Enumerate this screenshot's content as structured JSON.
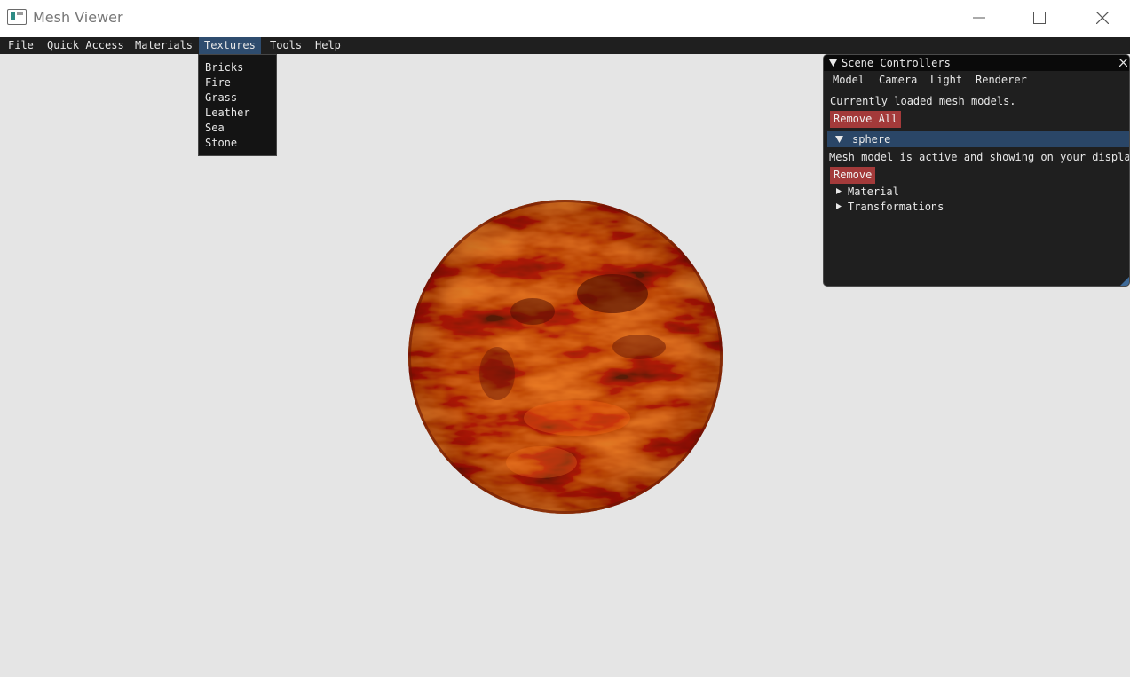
{
  "window": {
    "title": "Mesh Viewer",
    "controls": {
      "minimize": "minimize-icon",
      "maximize": "maximize-icon",
      "close": "close-icon"
    }
  },
  "menubar": {
    "items": [
      {
        "label": "File"
      },
      {
        "label": "Quick Access"
      },
      {
        "label": "Materials"
      },
      {
        "label": "Textures"
      },
      {
        "label": "Tools"
      },
      {
        "label": "Help"
      }
    ],
    "active": "Textures"
  },
  "textures_menu": {
    "items": [
      "Bricks",
      "Fire",
      "Grass",
      "Leather",
      "Sea",
      "Stone"
    ]
  },
  "scene": {
    "background": "#e5e5e5",
    "model": "sphere",
    "texture_colors": {
      "base": "#b8320c",
      "highlight": "#ff6a1a",
      "dark": "#4a0c02"
    }
  },
  "panel": {
    "title": "Scene Controllers",
    "collapse_icon": "triangle-down-icon",
    "close_icon": "close-icon",
    "tabs": [
      "Model",
      "Camera",
      "Light",
      "Renderer"
    ],
    "loaded_text": "Currently loaded mesh models.",
    "remove_all_label": "Remove All",
    "models": [
      {
        "name": "sphere",
        "status": "Mesh model is active and showing on your display",
        "remove_label": "Remove",
        "sections": [
          "Material",
          "Transformations"
        ]
      }
    ]
  },
  "colors": {
    "menubar": "#1f1f1f",
    "menu_active": "#2e4c6e",
    "panel_bg": "#1f1f1f",
    "tree_header": "#2a4667",
    "button_red": "#a33a3a"
  }
}
